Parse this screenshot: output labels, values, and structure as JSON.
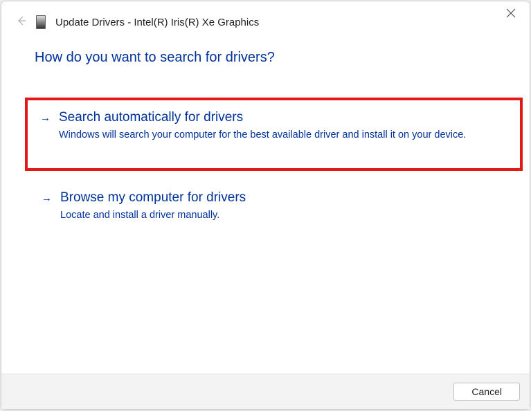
{
  "header": {
    "title": "Update Drivers - Intel(R) Iris(R) Xe Graphics"
  },
  "question": "How do you want to search for drivers?",
  "options": [
    {
      "title": "Search automatically for drivers",
      "description": "Windows will search your computer for the best available driver and install it on your device."
    },
    {
      "title": "Browse my computer for drivers",
      "description": "Locate and install a driver manually."
    }
  ],
  "footer": {
    "cancel_label": "Cancel"
  }
}
